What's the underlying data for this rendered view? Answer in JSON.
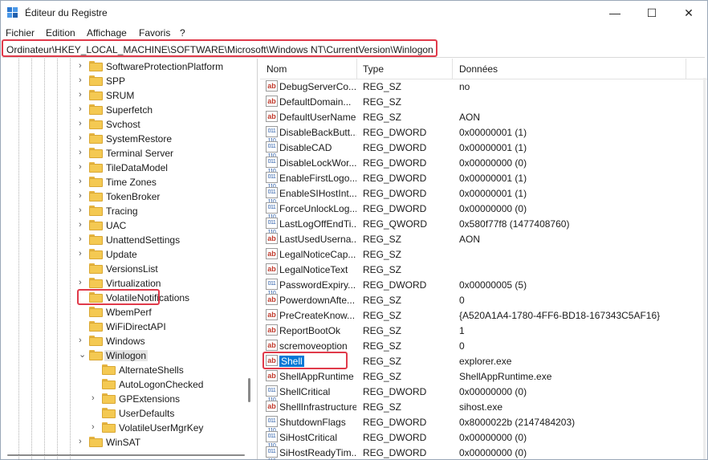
{
  "window": {
    "title": "Éditeur du Registre",
    "minimize": "—",
    "maximize": "☐",
    "close": "✕"
  },
  "menu": [
    "Fichier",
    "Edition",
    "Affichage",
    "Favoris",
    "?"
  ],
  "address": "Ordinateur\\HKEY_LOCAL_MACHINE\\SOFTWARE\\Microsoft\\Windows NT\\CurrentVersion\\Winlogon",
  "tree": [
    {
      "label": "SoftwareProtectionPlatform",
      "expandable": true,
      "level": 0
    },
    {
      "label": "SPP",
      "expandable": true,
      "level": 0
    },
    {
      "label": "SRUM",
      "expandable": true,
      "level": 0
    },
    {
      "label": "Superfetch",
      "expandable": true,
      "level": 0
    },
    {
      "label": "Svchost",
      "expandable": true,
      "level": 0
    },
    {
      "label": "SystemRestore",
      "expandable": true,
      "level": 0
    },
    {
      "label": "Terminal Server",
      "expandable": true,
      "level": 0
    },
    {
      "label": "TileDataModel",
      "expandable": true,
      "level": 0
    },
    {
      "label": "Time Zones",
      "expandable": true,
      "level": 0
    },
    {
      "label": "TokenBroker",
      "expandable": true,
      "level": 0
    },
    {
      "label": "Tracing",
      "expandable": true,
      "level": 0
    },
    {
      "label": "UAC",
      "expandable": true,
      "level": 0
    },
    {
      "label": "UnattendSettings",
      "expandable": true,
      "level": 0
    },
    {
      "label": "Update",
      "expandable": true,
      "level": 0
    },
    {
      "label": "VersionsList",
      "expandable": false,
      "level": 0
    },
    {
      "label": "Virtualization",
      "expandable": true,
      "level": 0
    },
    {
      "label": "VolatileNotifications",
      "expandable": false,
      "level": 0
    },
    {
      "label": "WbemPerf",
      "expandable": false,
      "level": 0
    },
    {
      "label": "WiFiDirectAPI",
      "expandable": false,
      "level": 0
    },
    {
      "label": "Windows",
      "expandable": true,
      "level": 0
    },
    {
      "label": "Winlogon",
      "expandable": true,
      "expanded": true,
      "selected": true,
      "level": 0
    },
    {
      "label": "AlternateShells",
      "expandable": false,
      "level": 1
    },
    {
      "label": "AutoLogonChecked",
      "expandable": false,
      "level": 1
    },
    {
      "label": "GPExtensions",
      "expandable": true,
      "level": 1
    },
    {
      "label": "UserDefaults",
      "expandable": false,
      "level": 1
    },
    {
      "label": "VolatileUserMgrKey",
      "expandable": true,
      "level": 1
    },
    {
      "label": "WinSAT",
      "expandable": true,
      "level": 0
    }
  ],
  "columns": {
    "name": "Nom",
    "type": "Type",
    "data": "Données"
  },
  "values": [
    {
      "name": "DebugServerCo...",
      "type": "REG_SZ",
      "data": "no",
      "kind": "sz"
    },
    {
      "name": "DefaultDomain...",
      "type": "REG_SZ",
      "data": "",
      "kind": "sz"
    },
    {
      "name": "DefaultUserName",
      "type": "REG_SZ",
      "data": "AON",
      "kind": "sz"
    },
    {
      "name": "DisableBackButt...",
      "type": "REG_DWORD",
      "data": "0x00000001 (1)",
      "kind": "num"
    },
    {
      "name": "DisableCAD",
      "type": "REG_DWORD",
      "data": "0x00000001 (1)",
      "kind": "num"
    },
    {
      "name": "DisableLockWor...",
      "type": "REG_DWORD",
      "data": "0x00000000 (0)",
      "kind": "num"
    },
    {
      "name": "EnableFirstLogo...",
      "type": "REG_DWORD",
      "data": "0x00000001 (1)",
      "kind": "num"
    },
    {
      "name": "EnableSIHostInt...",
      "type": "REG_DWORD",
      "data": "0x00000001 (1)",
      "kind": "num"
    },
    {
      "name": "ForceUnlockLog...",
      "type": "REG_DWORD",
      "data": "0x00000000 (0)",
      "kind": "num"
    },
    {
      "name": "LastLogOffEndTi...",
      "type": "REG_QWORD",
      "data": "0x580f77f8 (1477408760)",
      "kind": "num"
    },
    {
      "name": "LastUsedUserna...",
      "type": "REG_SZ",
      "data": "AON",
      "kind": "sz"
    },
    {
      "name": "LegalNoticeCap...",
      "type": "REG_SZ",
      "data": "",
      "kind": "sz"
    },
    {
      "name": "LegalNoticeText",
      "type": "REG_SZ",
      "data": "",
      "kind": "sz"
    },
    {
      "name": "PasswordExpiry...",
      "type": "REG_DWORD",
      "data": "0x00000005 (5)",
      "kind": "num"
    },
    {
      "name": "PowerdownAfte...",
      "type": "REG_SZ",
      "data": "0",
      "kind": "sz"
    },
    {
      "name": "PreCreateKnow...",
      "type": "REG_SZ",
      "data": "{A520A1A4-1780-4FF6-BD18-167343C5AF16}",
      "kind": "sz"
    },
    {
      "name": "ReportBootOk",
      "type": "REG_SZ",
      "data": "1",
      "kind": "sz"
    },
    {
      "name": "scremoveoption",
      "type": "REG_SZ",
      "data": "0",
      "kind": "sz"
    },
    {
      "name": "Shell",
      "type": "REG_SZ",
      "data": "explorer.exe",
      "kind": "sz",
      "selected": true
    },
    {
      "name": "ShellAppRuntime",
      "type": "REG_SZ",
      "data": "ShellAppRuntime.exe",
      "kind": "sz"
    },
    {
      "name": "ShellCritical",
      "type": "REG_DWORD",
      "data": "0x00000000 (0)",
      "kind": "num"
    },
    {
      "name": "ShellInfrastructure",
      "type": "REG_SZ",
      "data": "sihost.exe",
      "kind": "sz"
    },
    {
      "name": "ShutdownFlags",
      "type": "REG_DWORD",
      "data": "0x8000022b (2147484203)",
      "kind": "num"
    },
    {
      "name": "SiHostCritical",
      "type": "REG_DWORD",
      "data": "0x00000000 (0)",
      "kind": "num"
    },
    {
      "name": "SiHostReadyTim...",
      "type": "REG_DWORD",
      "data": "0x00000000 (0)",
      "kind": "num"
    }
  ],
  "icons": {
    "string_value": "ab",
    "numeric_value": "011 110"
  },
  "colors": {
    "highlight_red": "#e03a4a",
    "selection_blue": "#0078d7",
    "folder_yellow": "#f4c952"
  }
}
